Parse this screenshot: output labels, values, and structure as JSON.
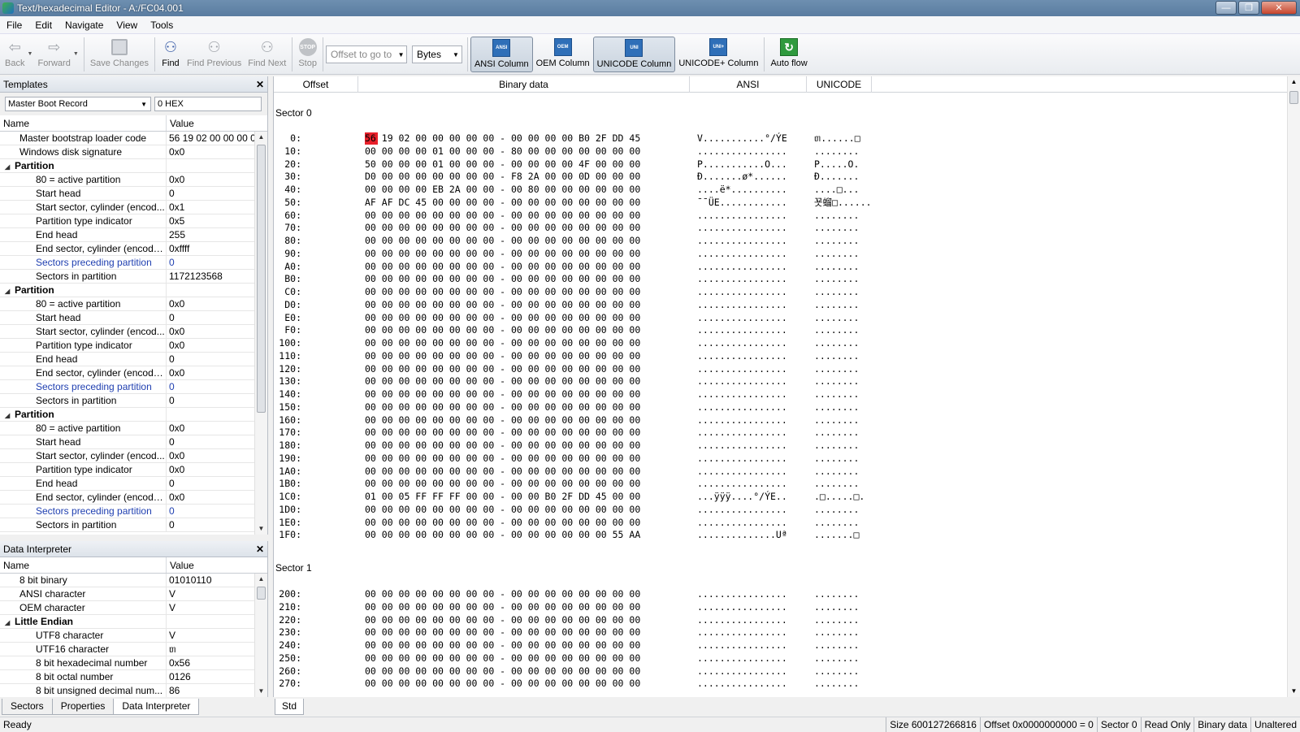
{
  "window": {
    "title": "Text/hexadecimal Editor - A:/FC04.001",
    "min": "—",
    "max": "❐",
    "close": "✕"
  },
  "menu": [
    "File",
    "Edit",
    "Navigate",
    "View",
    "Tools"
  ],
  "toolbar": {
    "back": "Back",
    "forward": "Forward",
    "save": "Save Changes",
    "find": "Find",
    "find_prev": "Find Previous",
    "find_next": "Find Next",
    "stop": "Stop",
    "offset_placeholder": "Offset to go to",
    "unit": "Bytes",
    "ansi_col": "ANSI Column",
    "oem_col": "OEM Column",
    "unicode_col": "UNICODE Column",
    "unicode_plus_col": "UNICODE+ Column",
    "auto_flow": "Auto flow",
    "ico_ansi": "ANSI",
    "ico_oem": "OEM",
    "ico_uni": "UNI",
    "ico_uniplus": "UNI+",
    "ico_stop": "STOP"
  },
  "templates": {
    "title": "Templates",
    "selected": "Master Boot Record",
    "offset": "0 HEX",
    "col_name": "Name",
    "col_value": "Value",
    "rows": [
      {
        "name": "Master bootstrap loader code",
        "value": "56 19 02 00 00 00 00 ..."
      },
      {
        "name": "Windows disk signature",
        "value": "0x0"
      },
      {
        "name": "Partition",
        "value": ""
      },
      {
        "name": "80 = active partition",
        "value": "0x0"
      },
      {
        "name": "Start head",
        "value": "0"
      },
      {
        "name": "Start sector, cylinder (encod...",
        "value": "0x1"
      },
      {
        "name": "Partition type indicator",
        "value": "0x5"
      },
      {
        "name": "End head",
        "value": "255"
      },
      {
        "name": "End sector, cylinder (encoded)",
        "value": "0xffff"
      },
      {
        "name": "Sectors preceding partition",
        "value": "0"
      },
      {
        "name": "Sectors in partition",
        "value": "1172123568"
      },
      {
        "name": "Partition",
        "value": ""
      },
      {
        "name": "80 = active partition",
        "value": "0x0"
      },
      {
        "name": "Start head",
        "value": "0"
      },
      {
        "name": "Start sector, cylinder (encod...",
        "value": "0x0"
      },
      {
        "name": "Partition type indicator",
        "value": "0x0"
      },
      {
        "name": "End head",
        "value": "0"
      },
      {
        "name": "End sector, cylinder (encoded)",
        "value": "0x0"
      },
      {
        "name": "Sectors preceding partition",
        "value": "0"
      },
      {
        "name": "Sectors in partition",
        "value": "0"
      },
      {
        "name": "Partition",
        "value": ""
      },
      {
        "name": "80 = active partition",
        "value": "0x0"
      },
      {
        "name": "Start head",
        "value": "0"
      },
      {
        "name": "Start sector, cylinder (encod...",
        "value": "0x0"
      },
      {
        "name": "Partition type indicator",
        "value": "0x0"
      },
      {
        "name": "End head",
        "value": "0"
      },
      {
        "name": "End sector, cylinder (encoded)",
        "value": "0x0"
      },
      {
        "name": "Sectors preceding partition",
        "value": "0"
      },
      {
        "name": "Sectors in partition",
        "value": "0"
      }
    ]
  },
  "interpreter": {
    "title": "Data Interpreter",
    "col_name": "Name",
    "col_value": "Value",
    "rows": [
      {
        "name": "8 bit binary",
        "value": "01010110"
      },
      {
        "name": "ANSI character",
        "value": "V"
      },
      {
        "name": "OEM character",
        "value": "V"
      },
      {
        "name": "Little Endian",
        "value": ""
      },
      {
        "name": "UTF8 character",
        "value": "V"
      },
      {
        "name": "UTF16 character",
        "value": "ᥖ"
      },
      {
        "name": "8 bit hexadecimal number",
        "value": "0x56"
      },
      {
        "name": "8 bit octal number",
        "value": "0126"
      },
      {
        "name": "8 bit unsigned decimal num...",
        "value": "86"
      }
    ]
  },
  "left_tabs": [
    "Sectors",
    "Properties",
    "Data Interpreter"
  ],
  "hex": {
    "columns": {
      "offset": "Offset",
      "binary": "Binary data",
      "ansi": "ANSI",
      "unicode": "UNICODE"
    },
    "sector0_label": "Sector 0",
    "sector1_label": "Sector 1",
    "sector0": [
      {
        "off": "0:",
        "hex": "56 19 02 00 00 00 00 00 - 00 00 00 00 B0 2F DD 45",
        "ansi": "V...........°/ÝE",
        "uni": "ᥖ......□"
      },
      {
        "off": "10:",
        "hex": "00 00 00 00 01 00 00 00 - 80 00 00 00 00 00 00 00",
        "ansi": "................",
        "uni": "........"
      },
      {
        "off": "20:",
        "hex": "50 00 00 00 01 00 00 00 - 00 00 00 00 4F 00 00 00",
        "ansi": "P...........O...",
        "uni": "P.....O."
      },
      {
        "off": "30:",
        "hex": "D0 00 00 00 00 00 00 00 - F8 2A 00 00 0D 00 00 00",
        "ansi": "Ð.......ø*......",
        "uni": "Ð......."
      },
      {
        "off": "40:",
        "hex": "00 00 00 00 EB 2A 00 00 - 00 80 00 00 00 00 00 00",
        "ansi": "....ë*..........",
        "uni": "....□..."
      },
      {
        "off": "50:",
        "hex": "AF AF DC 45 00 00 00 00 - 00 00 00 00 00 00 00 00",
        "ansi": "¯¯ÜE............",
        "uni": "꾯䗜□......"
      },
      {
        "off": "60:",
        "hex": "00 00 00 00 00 00 00 00 - 00 00 00 00 00 00 00 00",
        "ansi": "................",
        "uni": "........"
      },
      {
        "off": "70:",
        "hex": "00 00 00 00 00 00 00 00 - 00 00 00 00 00 00 00 00",
        "ansi": "................",
        "uni": "........"
      },
      {
        "off": "80:",
        "hex": "00 00 00 00 00 00 00 00 - 00 00 00 00 00 00 00 00",
        "ansi": "................",
        "uni": "........"
      },
      {
        "off": "90:",
        "hex": "00 00 00 00 00 00 00 00 - 00 00 00 00 00 00 00 00",
        "ansi": "................",
        "uni": "........"
      },
      {
        "off": "A0:",
        "hex": "00 00 00 00 00 00 00 00 - 00 00 00 00 00 00 00 00",
        "ansi": "................",
        "uni": "........"
      },
      {
        "off": "B0:",
        "hex": "00 00 00 00 00 00 00 00 - 00 00 00 00 00 00 00 00",
        "ansi": "................",
        "uni": "........"
      },
      {
        "off": "C0:",
        "hex": "00 00 00 00 00 00 00 00 - 00 00 00 00 00 00 00 00",
        "ansi": "................",
        "uni": "........"
      },
      {
        "off": "D0:",
        "hex": "00 00 00 00 00 00 00 00 - 00 00 00 00 00 00 00 00",
        "ansi": "................",
        "uni": "........"
      },
      {
        "off": "E0:",
        "hex": "00 00 00 00 00 00 00 00 - 00 00 00 00 00 00 00 00",
        "ansi": "................",
        "uni": "........"
      },
      {
        "off": "F0:",
        "hex": "00 00 00 00 00 00 00 00 - 00 00 00 00 00 00 00 00",
        "ansi": "................",
        "uni": "........"
      },
      {
        "off": "100:",
        "hex": "00 00 00 00 00 00 00 00 - 00 00 00 00 00 00 00 00",
        "ansi": "................",
        "uni": "........"
      },
      {
        "off": "110:",
        "hex": "00 00 00 00 00 00 00 00 - 00 00 00 00 00 00 00 00",
        "ansi": "................",
        "uni": "........"
      },
      {
        "off": "120:",
        "hex": "00 00 00 00 00 00 00 00 - 00 00 00 00 00 00 00 00",
        "ansi": "................",
        "uni": "........"
      },
      {
        "off": "130:",
        "hex": "00 00 00 00 00 00 00 00 - 00 00 00 00 00 00 00 00",
        "ansi": "................",
        "uni": "........"
      },
      {
        "off": "140:",
        "hex": "00 00 00 00 00 00 00 00 - 00 00 00 00 00 00 00 00",
        "ansi": "................",
        "uni": "........"
      },
      {
        "off": "150:",
        "hex": "00 00 00 00 00 00 00 00 - 00 00 00 00 00 00 00 00",
        "ansi": "................",
        "uni": "........"
      },
      {
        "off": "160:",
        "hex": "00 00 00 00 00 00 00 00 - 00 00 00 00 00 00 00 00",
        "ansi": "................",
        "uni": "........"
      },
      {
        "off": "170:",
        "hex": "00 00 00 00 00 00 00 00 - 00 00 00 00 00 00 00 00",
        "ansi": "................",
        "uni": "........"
      },
      {
        "off": "180:",
        "hex": "00 00 00 00 00 00 00 00 - 00 00 00 00 00 00 00 00",
        "ansi": "................",
        "uni": "........"
      },
      {
        "off": "190:",
        "hex": "00 00 00 00 00 00 00 00 - 00 00 00 00 00 00 00 00",
        "ansi": "................",
        "uni": "........"
      },
      {
        "off": "1A0:",
        "hex": "00 00 00 00 00 00 00 00 - 00 00 00 00 00 00 00 00",
        "ansi": "................",
        "uni": "........"
      },
      {
        "off": "1B0:",
        "hex": "00 00 00 00 00 00 00 00 - 00 00 00 00 00 00 00 00",
        "ansi": "................",
        "uni": "........"
      },
      {
        "off": "1C0:",
        "hex": "01 00 05 FF FF FF 00 00 - 00 00 B0 2F DD 45 00 00",
        "ansi": "...ÿÿÿ....°/ÝE..",
        "uni": ".□.....□."
      },
      {
        "off": "1D0:",
        "hex": "00 00 00 00 00 00 00 00 - 00 00 00 00 00 00 00 00",
        "ansi": "................",
        "uni": "........"
      },
      {
        "off": "1E0:",
        "hex": "00 00 00 00 00 00 00 00 - 00 00 00 00 00 00 00 00",
        "ansi": "................",
        "uni": "........"
      },
      {
        "off": "1F0:",
        "hex": "00 00 00 00 00 00 00 00 - 00 00 00 00 00 00 55 AA",
        "ansi": "..............Uª",
        "uni": ".......□"
      }
    ],
    "sector1": [
      {
        "off": "200:",
        "hex": "00 00 00 00 00 00 00 00 - 00 00 00 00 00 00 00 00",
        "ansi": "................",
        "uni": "........"
      },
      {
        "off": "210:",
        "hex": "00 00 00 00 00 00 00 00 - 00 00 00 00 00 00 00 00",
        "ansi": "................",
        "uni": "........"
      },
      {
        "off": "220:",
        "hex": "00 00 00 00 00 00 00 00 - 00 00 00 00 00 00 00 00",
        "ansi": "................",
        "uni": "........"
      },
      {
        "off": "230:",
        "hex": "00 00 00 00 00 00 00 00 - 00 00 00 00 00 00 00 00",
        "ansi": "................",
        "uni": "........"
      },
      {
        "off": "240:",
        "hex": "00 00 00 00 00 00 00 00 - 00 00 00 00 00 00 00 00",
        "ansi": "................",
        "uni": "........"
      },
      {
        "off": "250:",
        "hex": "00 00 00 00 00 00 00 00 - 00 00 00 00 00 00 00 00",
        "ansi": "................",
        "uni": "........"
      },
      {
        "off": "260:",
        "hex": "00 00 00 00 00 00 00 00 - 00 00 00 00 00 00 00 00",
        "ansi": "................",
        "uni": "........"
      },
      {
        "off": "270:",
        "hex": "00 00 00 00 00 00 00 00 - 00 00 00 00 00 00 00 00",
        "ansi": "................",
        "uni": "........"
      }
    ]
  },
  "bottom_tab_main": "Std",
  "status": {
    "ready": "Ready",
    "size": "Size 600127266816",
    "offset": "Offset 0x0000000000 = 0",
    "sector": "Sector 0",
    "mode": "Read Only",
    "data": "Binary data",
    "state": "Unaltered"
  },
  "colors": {
    "cursor": "#e8202a",
    "link": "#1f3fb0"
  }
}
